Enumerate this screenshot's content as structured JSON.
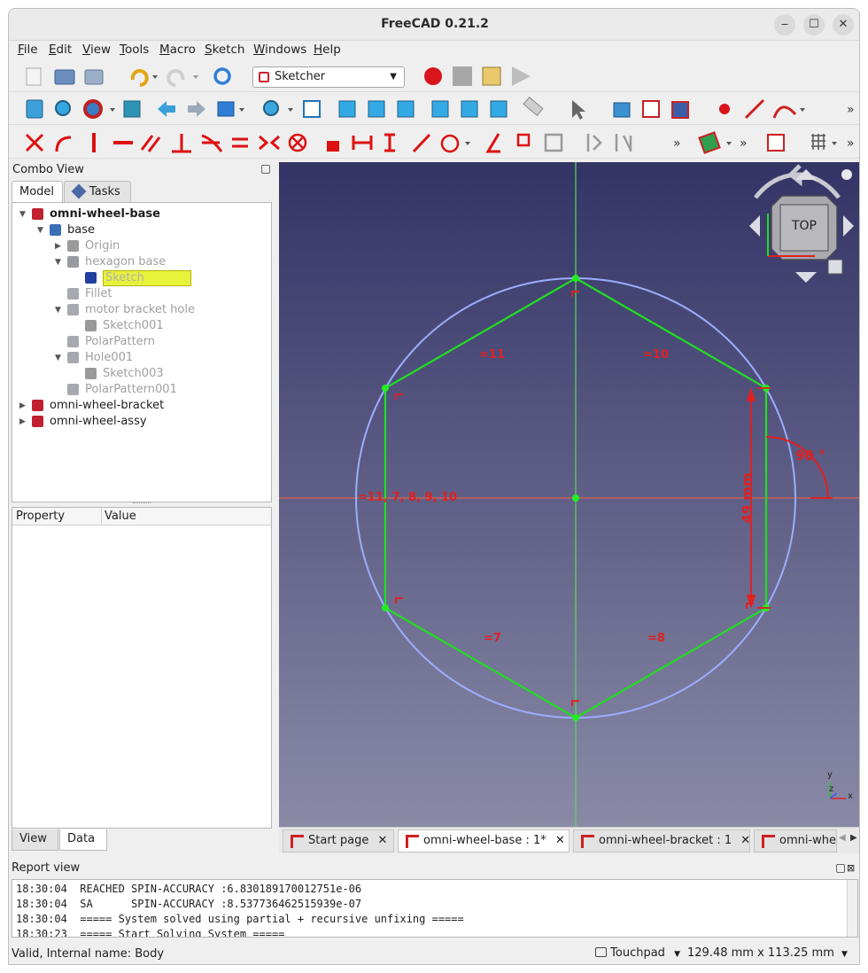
{
  "window": {
    "title": "FreeCAD 0.21.2"
  },
  "menu": [
    "File",
    "Edit",
    "View",
    "Tools",
    "Macro",
    "Sketch",
    "Windows",
    "Help"
  ],
  "workbench": {
    "selected": "Sketcher"
  },
  "combo_view": {
    "title": "Combo View",
    "tabs": [
      "Model",
      "Tasks"
    ],
    "bottom_tabs": [
      "View",
      "Data"
    ]
  },
  "tree": [
    {
      "label": "omni-wheel-base",
      "indent": 0,
      "arrow": "down",
      "icon": "body-icon",
      "style": "bold"
    },
    {
      "label": "base",
      "indent": 1,
      "arrow": "down",
      "icon": "part-icon",
      "style": "normal"
    },
    {
      "label": "Origin",
      "indent": 2,
      "arrow": "right",
      "icon": "origin-icon",
      "style": "dim"
    },
    {
      "label": "hexagon base",
      "indent": 2,
      "arrow": "down",
      "icon": "pad-icon",
      "style": "dim"
    },
    {
      "label": "Sketch",
      "indent": 3,
      "arrow": "",
      "icon": "sketch-edit-icon",
      "style": "selected"
    },
    {
      "label": "Fillet",
      "indent": 2,
      "arrow": "",
      "icon": "fillet-icon",
      "style": "dim"
    },
    {
      "label": "motor bracket hole",
      "indent": 2,
      "arrow": "down",
      "icon": "pocket-icon",
      "style": "dim"
    },
    {
      "label": "Sketch001",
      "indent": 3,
      "arrow": "",
      "icon": "sketch-icon",
      "style": "dim"
    },
    {
      "label": "PolarPattern",
      "indent": 2,
      "arrow": "",
      "icon": "polar-pattern-icon",
      "style": "dim"
    },
    {
      "label": "Hole001",
      "indent": 2,
      "arrow": "down",
      "icon": "hole-icon",
      "style": "dim"
    },
    {
      "label": "Sketch003",
      "indent": 3,
      "arrow": "",
      "icon": "sketch-icon",
      "style": "dim"
    },
    {
      "label": "PolarPattern001",
      "indent": 2,
      "arrow": "",
      "icon": "polar-pattern-icon",
      "style": "dim"
    },
    {
      "label": "omni-wheel-bracket",
      "indent": 0,
      "arrow": "right",
      "icon": "body-icon",
      "style": "normal"
    },
    {
      "label": "omni-wheel-assy",
      "indent": 0,
      "arrow": "right",
      "icon": "body-icon",
      "style": "normal"
    }
  ],
  "property_panel": {
    "headers": [
      "Property",
      "Value"
    ]
  },
  "sketch": {
    "constraint_labels": [
      "11",
      "10",
      "11, 7, 8, 9, 10",
      "7",
      "8"
    ],
    "dimension_length": "49 mm",
    "dimension_angle": "90 °"
  },
  "navcube": {
    "face": "TOP"
  },
  "axis_triad": {
    "x": "x",
    "y": "y",
    "z": "z"
  },
  "doc_tabs": [
    {
      "label": "Start page",
      "active": false
    },
    {
      "label": "omni-wheel-base : 1*",
      "active": true
    },
    {
      "label": "omni-wheel-bracket : 1",
      "active": false
    },
    {
      "label": "omni-wheel-assy",
      "active": false
    }
  ],
  "report_view": {
    "title": "Report view",
    "lines": [
      "18:30:04  REACHED SPIN-ACCURACY :6.830189170012751e-06",
      "18:30:04  SA      SPIN-ACCURACY :8.537736462515939e-07",
      "18:30:04  ===== System solved using partial + recursive unfixing =====",
      "18:30:23  ===== Start Solving System ====="
    ]
  },
  "status": {
    "left": "Valid, Internal name: Body",
    "navigation": "Touchpad",
    "dimensions": "129.48 mm x 113.25 mm"
  },
  "colors": {
    "sketch_line": "#22dd22",
    "constraint": "#dd2222",
    "circle": "#99aaff"
  }
}
